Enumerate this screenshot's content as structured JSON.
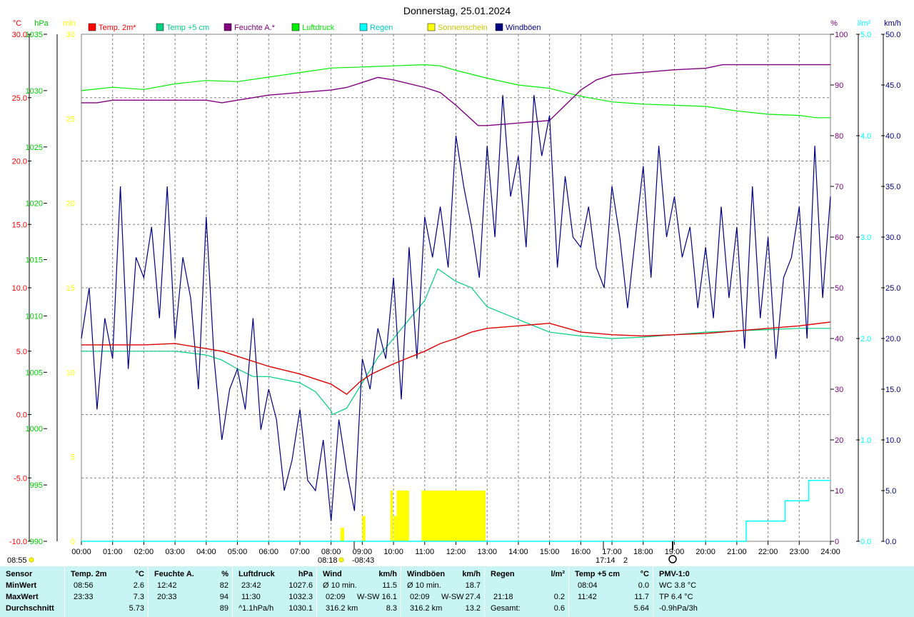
{
  "chart_data": {
    "type": "line",
    "title": "Donnerstag, 25.01.2024",
    "axes": {
      "left": [
        {
          "unit": "°C",
          "color": "#ff0000",
          "range": [
            -10,
            30
          ],
          "ticks": [
            "30.0",
            "25.0",
            "20.0",
            "15.0",
            "10.0",
            "5.0",
            "0.0",
            "-5.0",
            "-10.0"
          ]
        },
        {
          "unit": "hPa",
          "color": "#00cc00",
          "range": [
            990,
            1035
          ],
          "ticks": [
            "1035",
            "1030",
            "1025",
            "1020",
            "1015",
            "1010",
            "1005",
            "1000",
            "995",
            "990"
          ]
        },
        {
          "unit": "min",
          "color": "#ffff00",
          "range": [
            0,
            30
          ],
          "ticks": [
            "30",
            "25",
            "20",
            "15",
            "10",
            "5",
            "0"
          ]
        }
      ],
      "right": [
        {
          "unit": "%",
          "color": "#800080",
          "range": [
            0,
            100
          ],
          "ticks": [
            "100",
            "90",
            "80",
            "70",
            "60",
            "50",
            "40",
            "30",
            "20",
            "10",
            "0"
          ]
        },
        {
          "unit": "l/m²",
          "color": "#00ffff",
          "range": [
            0,
            5
          ],
          "ticks": [
            "5.0",
            "4.0",
            "3.0",
            "2.0",
            "1.0",
            "0.0"
          ]
        },
        {
          "unit": "km/h",
          "color": "#000080",
          "range": [
            0,
            50
          ],
          "ticks": [
            "50.0",
            "45.0",
            "40.0",
            "35.0",
            "30.0",
            "25.0",
            "20.0",
            "15.0",
            "10.0",
            "5.0",
            "0.0"
          ]
        }
      ],
      "x_ticks": [
        "00:00",
        "01:00",
        "02:00",
        "03:00",
        "04:00",
        "05:00",
        "06:00",
        "07:00",
        "08:00",
        "09:00",
        "10:00",
        "11:00",
        "12:00",
        "13:00",
        "14:00",
        "15:00",
        "16:00",
        "17:00",
        "18:00",
        "19:00",
        "20:00",
        "21:00",
        "22:00",
        "23:00",
        "24:00"
      ]
    },
    "legend": [
      {
        "name": "Temp. 2m*",
        "color": "#ff0000"
      },
      {
        "name": "Temp +5 cm",
        "color": "#00d080"
      },
      {
        "name": "Feuchte A.*",
        "color": "#800080"
      },
      {
        "name": "Luftdruck",
        "color": "#00ee00"
      },
      {
        "name": "Regen",
        "color": "#00ffff"
      },
      {
        "name": "Sonnenschein",
        "color": "#ffff00"
      },
      {
        "name": "Windböen",
        "color": "#000080"
      }
    ],
    "series": {
      "temp2m": {
        "name": "Temp. 2m*",
        "axis": "°C",
        "x_hours": [
          0,
          1,
          2,
          3,
          4,
          4.5,
          5,
          6,
          7,
          8,
          8.5,
          8.93,
          9.3,
          10,
          11,
          11.5,
          12,
          12.5,
          13,
          14,
          15,
          16,
          17,
          18,
          19,
          20,
          21,
          22,
          23,
          24
        ],
        "y": [
          5.5,
          5.5,
          5.5,
          5.6,
          5.2,
          5.0,
          4.6,
          3.8,
          3.2,
          2.4,
          1.6,
          2.6,
          3.2,
          4.0,
          5.0,
          5.6,
          6.0,
          6.5,
          6.8,
          7.0,
          7.2,
          6.5,
          6.3,
          6.2,
          6.3,
          6.4,
          6.6,
          6.8,
          7.0,
          7.3
        ]
      },
      "temp5cm": {
        "name": "Temp +5 cm",
        "axis": "°C",
        "x_hours": [
          0,
          2,
          3,
          4,
          4.5,
          5,
          5.5,
          6,
          7,
          7.5,
          8,
          8.04,
          8.5,
          9,
          9.5,
          10,
          10.5,
          11,
          11.42,
          12,
          12.5,
          13,
          13.5,
          14,
          15,
          16,
          17,
          18,
          19,
          20,
          21,
          22,
          23,
          24
        ],
        "y": [
          5.0,
          5.0,
          5.0,
          4.7,
          4.3,
          3.6,
          3.0,
          3.0,
          2.5,
          1.8,
          0.3,
          0.0,
          0.5,
          2.5,
          4.5,
          6.0,
          7.5,
          9.0,
          11.5,
          10.5,
          10.0,
          8.5,
          8.0,
          7.5,
          6.5,
          6.2,
          6.0,
          6.1,
          6.3,
          6.5,
          6.6,
          6.7,
          6.8,
          6.8
        ]
      },
      "humidity": {
        "name": "Feuchte A.*",
        "axis": "%",
        "x_hours": [
          0,
          0.5,
          1,
          1.5,
          2,
          3,
          4,
          4.5,
          5,
          6,
          7,
          8,
          8.5,
          9,
          9.5,
          10,
          11,
          11.5,
          12,
          12.71,
          13,
          14,
          15,
          15.5,
          16,
          16.5,
          17,
          18,
          19,
          20,
          20.55,
          21,
          22,
          23,
          24
        ],
        "y": [
          86.5,
          86.5,
          87,
          87,
          87,
          87,
          87,
          86.5,
          87,
          88,
          88.5,
          89,
          89.5,
          90.5,
          91.5,
          91,
          89.5,
          88.5,
          86,
          82,
          82,
          82.5,
          83,
          86,
          89,
          91,
          92,
          92.5,
          93,
          93.3,
          94,
          94,
          94,
          94,
          94
        ]
      },
      "pressure": {
        "name": "Luftdruck",
        "axis": "hPa",
        "x_hours": [
          0,
          1,
          2,
          3,
          4,
          5,
          6,
          7,
          8,
          9,
          10,
          11,
          11.5,
          12,
          13,
          14,
          15,
          16,
          17,
          18,
          19,
          20,
          21,
          22,
          23,
          23.55,
          24
        ],
        "y": [
          1030.0,
          1030.3,
          1030.1,
          1030.6,
          1030.9,
          1030.8,
          1031.2,
          1031.6,
          1032.0,
          1032.1,
          1032.2,
          1032.3,
          1032.2,
          1031.8,
          1031.1,
          1030.5,
          1030.2,
          1029.5,
          1029.0,
          1028.8,
          1028.7,
          1028.6,
          1028.2,
          1027.9,
          1027.8,
          1027.6,
          1027.6
        ]
      },
      "rain": {
        "name": "Regen",
        "axis": "l/m²",
        "x_hours": [
          0,
          21.3,
          21.3,
          22.55,
          22.55,
          23.3,
          23.3,
          23.7,
          23.7,
          24
        ],
        "y": [
          0,
          0,
          0.2,
          0.2,
          0.4,
          0.4,
          0.6,
          0.6,
          0.6,
          0.6
        ]
      },
      "sunshine": {
        "name": "Sonnenschein",
        "axis": "min",
        "bars": [
          {
            "from": 8.3,
            "to": 8.42,
            "value": 0.8
          },
          {
            "from": 9.0,
            "to": 9.1,
            "value": 1.5
          },
          {
            "from": 9.9,
            "to": 9.98,
            "value": 3.0
          },
          {
            "from": 10.0,
            "to": 10.1,
            "value": 1.5
          },
          {
            "from": 10.1,
            "to": 10.5,
            "value": 3.0
          },
          {
            "from": 10.9,
            "to": 12.0,
            "value": 3.0
          },
          {
            "from": 12.0,
            "to": 12.95,
            "value": 3.0
          }
        ]
      },
      "gusts": {
        "name": "Windböen",
        "axis": "km/h",
        "x_hours": [
          0,
          0.25,
          0.5,
          0.75,
          1,
          1.25,
          1.5,
          1.75,
          2,
          2.25,
          2.5,
          2.75,
          3,
          3.25,
          3.5,
          3.75,
          4,
          4.25,
          4.5,
          4.75,
          5,
          5.25,
          5.5,
          5.75,
          6,
          6.25,
          6.5,
          6.75,
          7,
          7.25,
          7.5,
          7.75,
          8,
          8.25,
          8.5,
          8.75,
          9,
          9.25,
          9.5,
          9.75,
          10,
          10.25,
          10.5,
          10.75,
          11,
          11.25,
          11.5,
          11.75,
          12,
          12.25,
          12.5,
          12.75,
          13,
          13.25,
          13.5,
          13.75,
          14,
          14.25,
          14.5,
          14.75,
          15,
          15.25,
          15.5,
          15.75,
          16,
          16.25,
          16.5,
          16.75,
          17,
          17.25,
          17.5,
          17.75,
          18,
          18.25,
          18.5,
          18.75,
          19,
          19.25,
          19.5,
          19.75,
          20,
          20.25,
          20.5,
          20.75,
          21,
          21.25,
          21.5,
          21.75,
          22,
          22.25,
          22.5,
          22.75,
          23,
          23.25,
          23.5,
          23.75,
          24
        ],
        "y": [
          20,
          25,
          13,
          22,
          18,
          35,
          17,
          28,
          26,
          31,
          22,
          35,
          20,
          28,
          24,
          15,
          32,
          18,
          10,
          15,
          17,
          13,
          22,
          11,
          15,
          12,
          5,
          8,
          13,
          6,
          5,
          10,
          2,
          12,
          7,
          3,
          18,
          15,
          21,
          18,
          26,
          14,
          29,
          18,
          32,
          28,
          33,
          27,
          40,
          35,
          31,
          26,
          39,
          30,
          44,
          34,
          38,
          29,
          44,
          38,
          42,
          27,
          36,
          30,
          29,
          33,
          27,
          25,
          35,
          30,
          23,
          30,
          37,
          26,
          39,
          30,
          34,
          28,
          31,
          23,
          29,
          22,
          33,
          24,
          31,
          19,
          35,
          22,
          30,
          18,
          26,
          28,
          33,
          20,
          39,
          24,
          34,
          50,
          28
        ]
      }
    }
  },
  "header": {
    "left_time": "08:55",
    "sun_markers": [
      "08:18",
      "-08:43"
    ],
    "mid_markers": [
      "17:14",
      "2"
    ]
  },
  "stats": {
    "columns": [
      {
        "title": "Sensor",
        "unit": "",
        "rows": [
          {
            "a": "MinWert"
          },
          {
            "a": "MaxWert"
          },
          {
            "a": "Durchschnitt"
          }
        ]
      },
      {
        "title": "Temp. 2m",
        "unit": "°C",
        "rows": [
          {
            "a": "08:56",
            "b": "",
            "c": "2.6"
          },
          {
            "a": "23:33",
            "b": "",
            "c": "7.3"
          },
          {
            "a": "",
            "b": "",
            "c": "5.73"
          }
        ]
      },
      {
        "title": "Feuchte A.",
        "unit": "%",
        "rows": [
          {
            "a": "12:42",
            "b": "",
            "c": "82"
          },
          {
            "a": "20:33",
            "b": "",
            "c": "94"
          },
          {
            "a": "",
            "b": "",
            "c": "89"
          }
        ]
      },
      {
        "title": "Luftdruck",
        "unit": "hPa",
        "rows": [
          {
            "a": "23:42",
            "b": "",
            "c": "1027.6"
          },
          {
            "a": "11:30",
            "b": "",
            "c": "1032.3"
          },
          {
            "a": "^1.1hPa/h",
            "b": "",
            "c": "1030.1"
          }
        ]
      },
      {
        "title": "Wind",
        "unit": "km/h",
        "rows": [
          {
            "a": "Ø 10 min.",
            "b": "",
            "c": "11.5"
          },
          {
            "a": "02:09",
            "b": "W-SW",
            "c": "16.1"
          },
          {
            "a": "316.2 km",
            "b": "",
            "c": "8.3"
          }
        ]
      },
      {
        "title": "Windböen",
        "unit": "km/h",
        "rows": [
          {
            "a": "Ø 10 min.",
            "b": "",
            "c": "18.7"
          },
          {
            "a": "02:09",
            "b": "W-SW",
            "c": "27.4"
          },
          {
            "a": "316.2 km",
            "b": "",
            "c": "13.2"
          }
        ]
      },
      {
        "title": "Regen",
        "unit": "l/m²",
        "rows": [
          {
            "a": "",
            "b": "",
            "c": ""
          },
          {
            "a": "21:18",
            "b": "",
            "c": "0.2"
          },
          {
            "a": "Gesamt:",
            "b": "",
            "c": "0.6"
          }
        ]
      },
      {
        "title": "Temp +5 cm",
        "unit": "°C",
        "rows": [
          {
            "a": "08:04",
            "b": "",
            "c": "0.0"
          },
          {
            "a": "11:42",
            "b": "",
            "c": "11.7"
          },
          {
            "a": "",
            "b": "",
            "c": "5.64"
          }
        ]
      },
      {
        "title": "PMV-1:0",
        "unit": "",
        "rows": [
          {
            "a": "WC 3.8 °C"
          },
          {
            "a": "TP 6.4 °C"
          },
          {
            "a": "-0.9hPa/3h"
          }
        ]
      }
    ]
  }
}
